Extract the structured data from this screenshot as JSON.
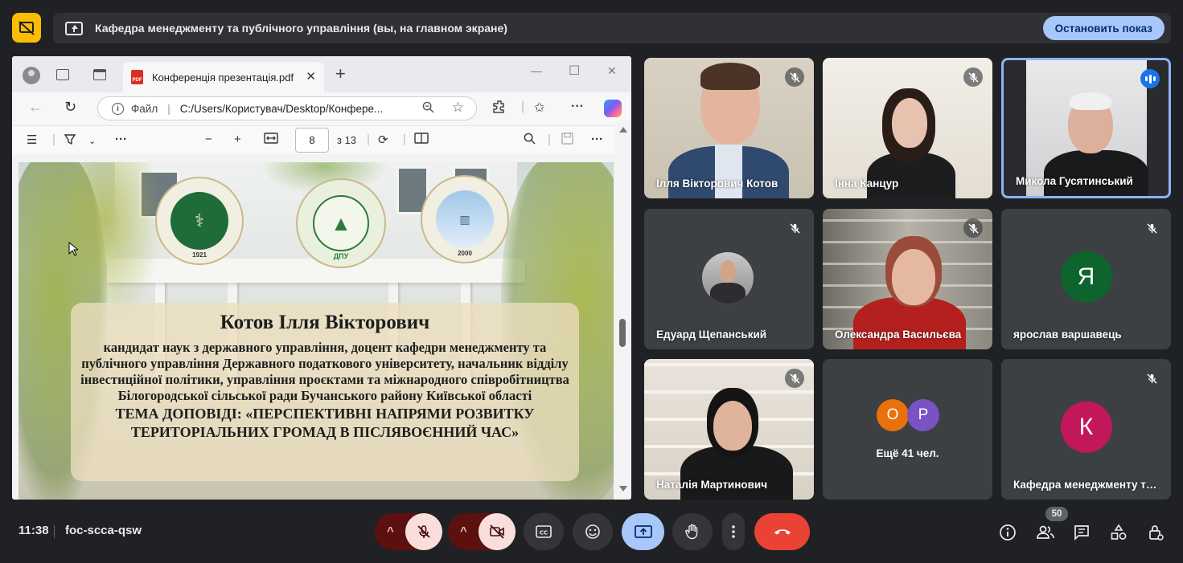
{
  "banner": {
    "title": "Кафедра менеджменту та публічного управління (вы, на главном экране)",
    "stop_label": "Остановить показ"
  },
  "browser": {
    "tab_title": "Конференція презентація.pdf",
    "url_scheme_label": "Файл",
    "url": "C:/Users/Користувач/Desktop/Конфере...",
    "page_current": "8",
    "page_total": "з 13"
  },
  "slide": {
    "name": "Котов Ілля Вікторович",
    "description": "кандидат наук з державного управління, доцент кафедри менеджменту та публічного управління Державного податкового університету, начальник відділу інвестиційної політики, управління проєктами та міжнародного співробітництва Білогородської сільської ради Бучанського району Київської області",
    "topic": "ТЕМА ДОПОВІДІ: «ПЕРСПЕКТИВНІ НАПРЯМИ РОЗВИТКУ ТЕРИТОРІАЛЬНИХ ГРОМАД В ПІСЛЯВОЄННИЙ ЧАС»",
    "seal1_year": "1921",
    "seal2_abbr": "ДПУ",
    "seal3_year": "2000"
  },
  "participants": [
    {
      "name": "Ілля Вікторович Котов",
      "muted": true
    },
    {
      "name": "Інна Канцур",
      "muted": true
    },
    {
      "name": "Микола Гусятинський",
      "speaking": true
    },
    {
      "name": "Едуард Щепанський",
      "muted": true
    },
    {
      "name": "Олександра Васильєва",
      "muted": true
    },
    {
      "name": "ярослав варшавець",
      "muted": true,
      "initial": "Я",
      "color": "#0d652d"
    },
    {
      "name": "Наталія Мартинович",
      "muted": true
    },
    {
      "name": "Ещё 41 чел.",
      "initials": [
        "О",
        "Р"
      ],
      "colors": [
        "#e8710a",
        "#7b52c4"
      ]
    },
    {
      "name": "Кафедра менеджменту т…",
      "muted": true,
      "initial": "К",
      "color": "#c2185b"
    }
  ],
  "bottom": {
    "time": "11:38",
    "meeting_code": "foc-scca-qsw",
    "participants_count": "50"
  },
  "colors": {
    "background": "#202124",
    "accent": "#a8c7fa",
    "end_call": "#ea4335",
    "mic_off_bg": "#f9dedc",
    "present_active": "#a8c7fa"
  }
}
